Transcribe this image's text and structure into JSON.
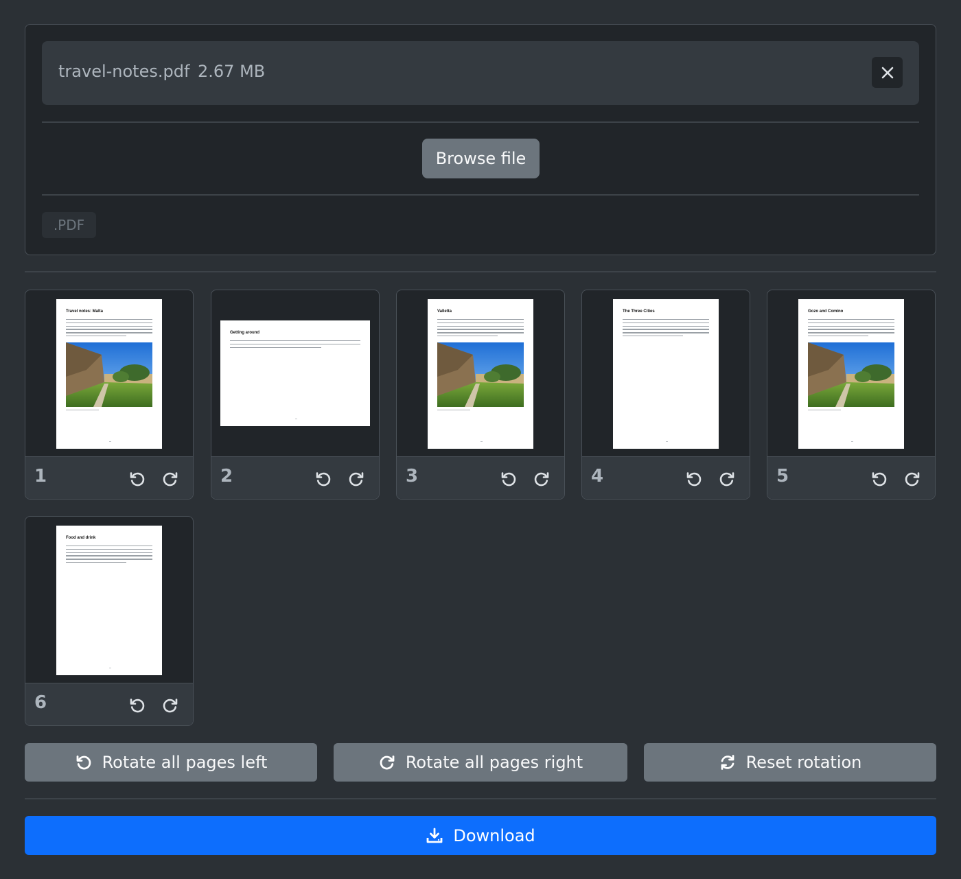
{
  "upload": {
    "file_name": "travel-notes.pdf",
    "file_size": "2.67 MB",
    "browse_label": "Browse file",
    "accepted_ext": ".PDF"
  },
  "pages": [
    {
      "number": "1",
      "title": "Travel notes: Malta",
      "orientation": "portrait",
      "has_photo": true
    },
    {
      "number": "2",
      "title": "Getting around",
      "orientation": "landscape",
      "has_photo": false
    },
    {
      "number": "3",
      "title": "Valletta",
      "orientation": "portrait",
      "has_photo": true
    },
    {
      "number": "4",
      "title": "The Three Cities",
      "orientation": "portrait",
      "has_photo": false
    },
    {
      "number": "5",
      "title": "Gozo and Comino",
      "orientation": "portrait",
      "has_photo": true
    },
    {
      "number": "6",
      "title": "Food and drink",
      "orientation": "portrait",
      "has_photo": false
    }
  ],
  "actions": {
    "rotate_all_left": "Rotate all pages left",
    "rotate_all_right": "Rotate all pages right",
    "reset_rotation": "Reset rotation",
    "download": "Download"
  },
  "colors": {
    "background": "#2b3035",
    "card": "#212529",
    "secondary_button": "#6c757d",
    "primary_button": "#0d6efd"
  },
  "icons": [
    "close-icon",
    "rotate-left-icon",
    "rotate-right-icon",
    "reset-icon",
    "download-icon"
  ]
}
